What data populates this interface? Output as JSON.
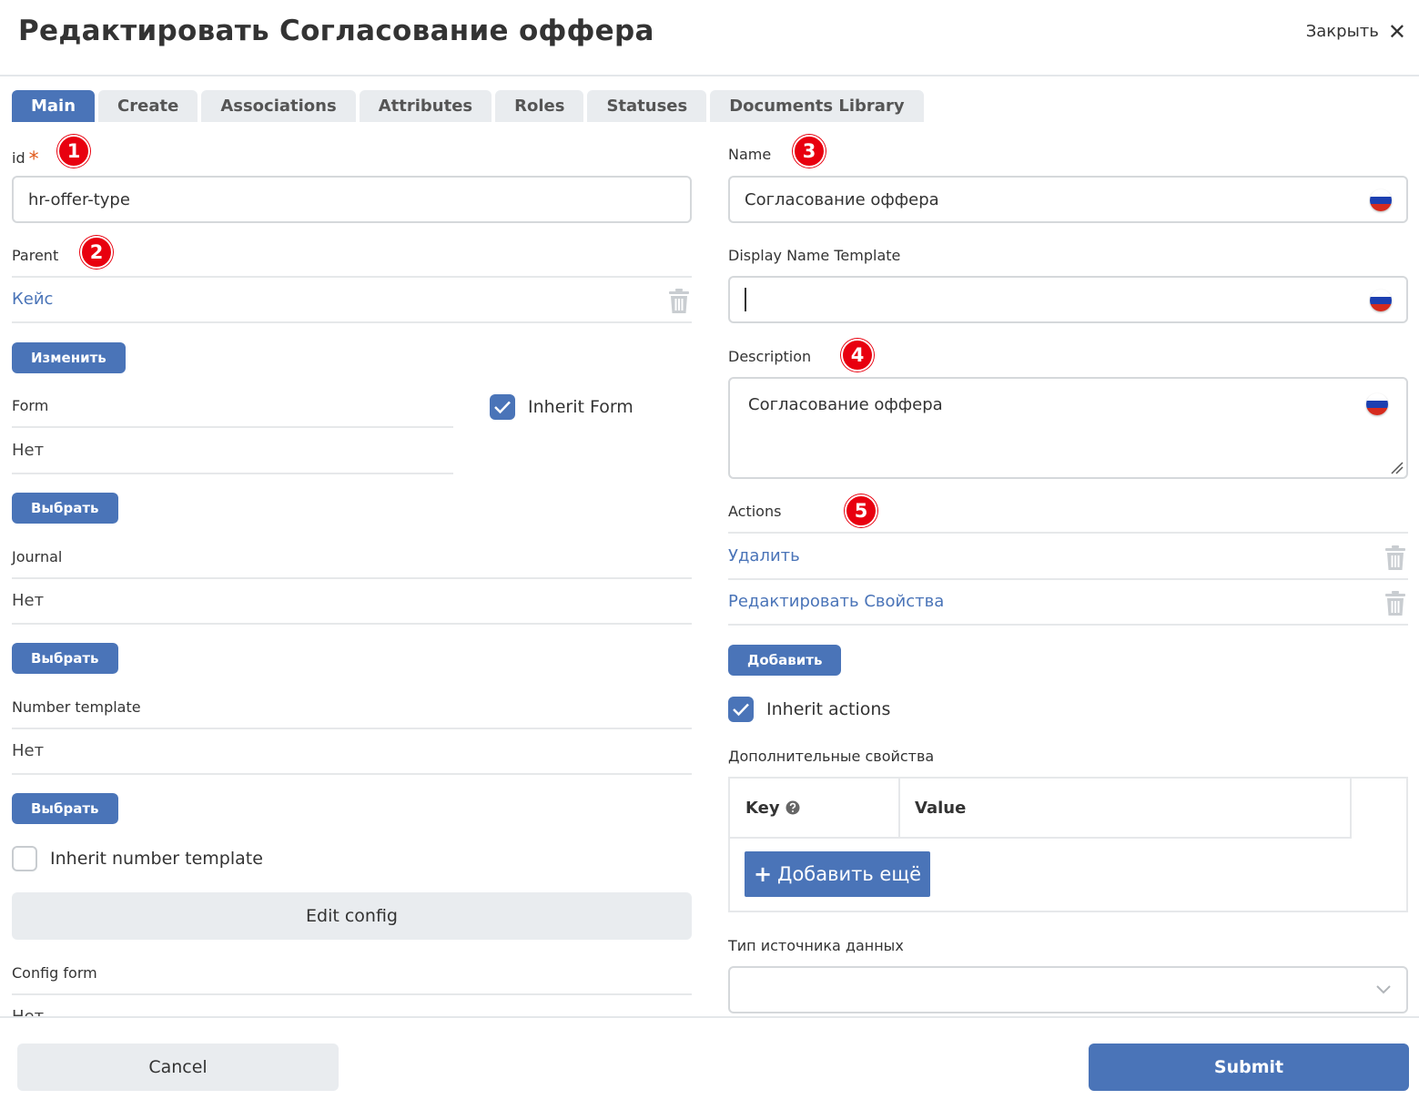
{
  "header": {
    "title": "Редактировать Согласование оффера",
    "close_label": "Закрыть"
  },
  "tabs": [
    {
      "label": "Main",
      "active": true
    },
    {
      "label": "Create"
    },
    {
      "label": "Associations"
    },
    {
      "label": "Attributes"
    },
    {
      "label": "Roles"
    },
    {
      "label": "Statuses"
    },
    {
      "label": "Documents Library"
    }
  ],
  "badges": [
    "1",
    "2",
    "3",
    "4",
    "5"
  ],
  "left": {
    "id": {
      "label": "id",
      "required_mark": "*",
      "value": "hr-offer-type"
    },
    "parent": {
      "label": "Parent",
      "value": "Кейс",
      "change_button": "Изменить"
    },
    "form": {
      "label": "Form",
      "value": "Нет",
      "select_button": "Выбрать",
      "inherit_label": "Inherit Form",
      "inherit_checked": true
    },
    "journal": {
      "label": "Journal",
      "value": "Нет",
      "select_button": "Выбрать"
    },
    "number_template": {
      "label": "Number template",
      "value": "Нет",
      "select_button": "Выбрать",
      "inherit_label": "Inherit number template",
      "inherit_checked": false
    },
    "edit_config": "Edit config",
    "config_form": {
      "label": "Config form",
      "value": "Нет"
    }
  },
  "right": {
    "name": {
      "label": "Name",
      "value": "Согласование оффера"
    },
    "display_name_template": {
      "label": "Display Name Template",
      "value": ""
    },
    "description": {
      "label": "Description",
      "value": "Согласование оффера"
    },
    "actions": {
      "label": "Actions",
      "items": [
        "Удалить",
        "Редактировать Свойства"
      ],
      "add_button": "Добавить",
      "inherit_label": "Inherit actions",
      "inherit_checked": true
    },
    "extra_props": {
      "label": "Дополнительные свойства",
      "key_header": "Key",
      "value_header": "Value",
      "add_more": "Добавить ещё"
    },
    "datasource": {
      "label": "Тип источника данных",
      "value": ""
    }
  },
  "footer": {
    "cancel": "Cancel",
    "submit": "Submit"
  },
  "colors": {
    "primary": "#4a74b8",
    "badge": "#e8000f",
    "required": "#e05a1b",
    "link": "#4a74b8"
  }
}
